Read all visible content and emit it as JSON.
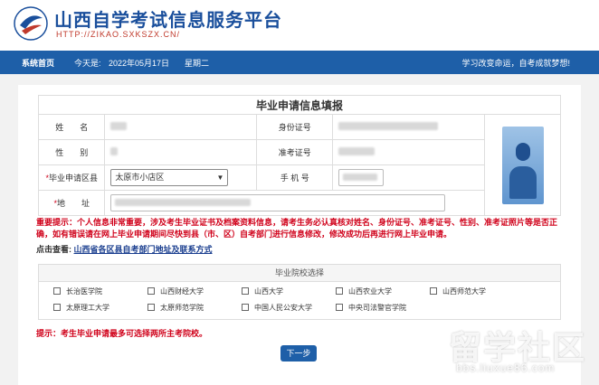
{
  "header": {
    "title": "山西自学考试信息服务平台",
    "url": "HTTP://ZIKAO.SXKSZX.CN/"
  },
  "nav": {
    "home": "系统首页",
    "today_label": "今天是:",
    "date": "2022年05月17日",
    "weekday": "星期二",
    "slogan": "学习改变命运，自考成就梦想!"
  },
  "form": {
    "title": "毕业申请信息填报",
    "name_label": "姓　　名",
    "id_label": "身份证号",
    "gender_label": "性　　别",
    "exam_no_label": "准考证号",
    "region_label": "毕业申请区县",
    "region_value": "太原市小店区",
    "phone_label": "手 机 号",
    "address_label": "地　　址"
  },
  "notice": {
    "text": "重要提示：个人信息非常重要，涉及考生毕业证书及档案资料信息，请考生务必认真核对姓名、身份证号、准考证号、性别、准考证照片等是否正确，如有错误请在网上毕业申请期间尽快到县（市、区）自考部门进行信息修改，修改成功后再进行网上毕业申请。",
    "check_label": "点击查看:",
    "check_link": "山西省各区县自考部门地址及联系方式"
  },
  "schools": {
    "heading": "毕业院校选择",
    "items": [
      "长治医学院",
      "山西财经大学",
      "山西大学",
      "山西农业大学",
      "山西师范大学",
      "太原理工大学",
      "太原师范学院",
      "中国人民公安大学",
      "中央司法警官学院"
    ]
  },
  "tip": "提示：考生毕业申请最多可选择两所主考院校。",
  "next_button": "下一步",
  "watermark": {
    "text": "留学社区",
    "url": "bbs.liuxue86.com"
  },
  "colors": {
    "brand_blue": "#1e5fa8",
    "alert_red": "#d0021b"
  }
}
